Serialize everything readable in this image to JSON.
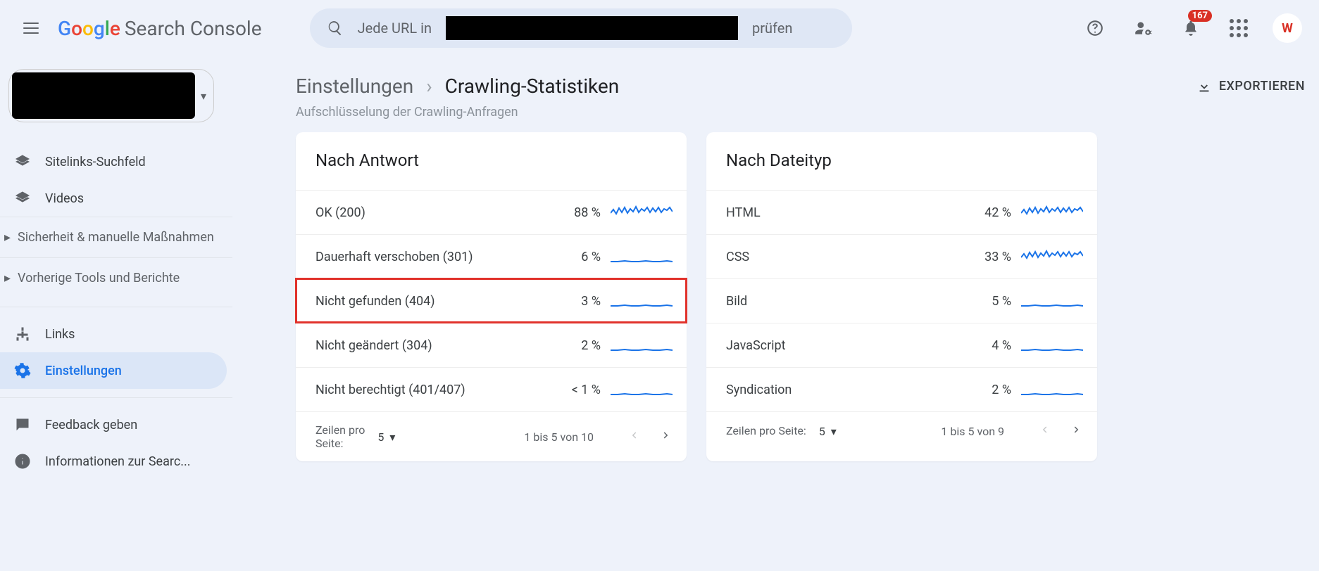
{
  "brand": {
    "name": "Search Console"
  },
  "search": {
    "prefix": "Jede URL in",
    "suffix": "prüfen"
  },
  "notifications": {
    "count": "167"
  },
  "avatar": {
    "initials": "W"
  },
  "sidebar": {
    "items": [
      {
        "label": "Sitelinks-Suchfeld"
      },
      {
        "label": "Videos"
      }
    ],
    "groups": [
      {
        "label": "Sicherheit & manuelle Maßnahmen"
      },
      {
        "label": "Vorherige Tools und Berichte"
      }
    ],
    "bottom": [
      {
        "label": "Links"
      },
      {
        "label": "Einstellungen"
      },
      {
        "label": "Feedback geben"
      },
      {
        "label": "Informationen zur Searc..."
      }
    ]
  },
  "breadcrumb": {
    "a": "Einstellungen",
    "b": "Crawling-Statistiken"
  },
  "export_label": "EXPORTIEREN",
  "section_subhead": "Aufschlüsselung der Crawling-Anfragen",
  "cards": {
    "response": {
      "title": "Nach Antwort",
      "rows": [
        {
          "label": "OK (200)",
          "pct": "88 %",
          "spark": "noisy"
        },
        {
          "label": "Dauerhaft verschoben (301)",
          "pct": "6 %",
          "spark": "flat"
        },
        {
          "label": "Nicht gefunden (404)",
          "pct": "3 %",
          "spark": "flat",
          "highlight": true
        },
        {
          "label": "Nicht geändert (304)",
          "pct": "2 %",
          "spark": "flat"
        },
        {
          "label": "Nicht berechtigt (401/407)",
          "pct": "< 1 %",
          "spark": "flat"
        }
      ],
      "pager": {
        "rpp_label": "Zeilen pro\nSeite:",
        "rpp_value": "5",
        "range": "1 bis 5 von 10"
      }
    },
    "filetype": {
      "title": "Nach Dateityp",
      "rows": [
        {
          "label": "HTML",
          "pct": "42 %",
          "spark": "noisy"
        },
        {
          "label": "CSS",
          "pct": "33 %",
          "spark": "noisy"
        },
        {
          "label": "Bild",
          "pct": "5 %",
          "spark": "flat"
        },
        {
          "label": "JavaScript",
          "pct": "4 %",
          "spark": "flat"
        },
        {
          "label": "Syndication",
          "pct": "2 %",
          "spark": "flat"
        }
      ],
      "pager": {
        "rpp_label": "Zeilen pro Seite:",
        "rpp_value": "5",
        "range": "1 bis 5 von 9"
      }
    }
  }
}
